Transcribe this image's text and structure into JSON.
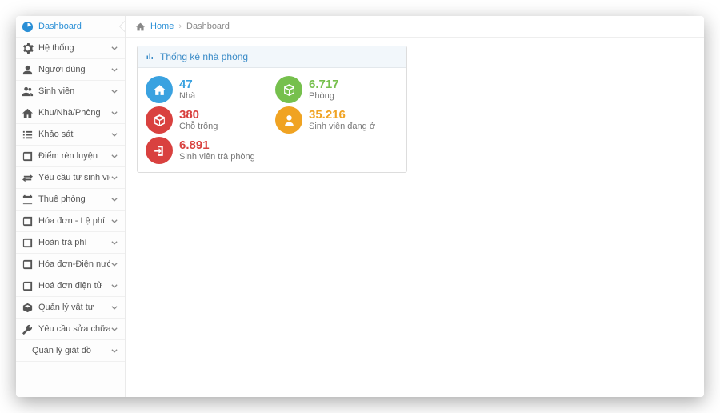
{
  "breadcrumb": {
    "home": "Home",
    "current": "Dashboard"
  },
  "sidebar": {
    "items": [
      {
        "icon": "dashboard",
        "label": "Dashboard",
        "active": true,
        "expandable": false
      },
      {
        "icon": "gears",
        "label": "Hệ thống",
        "active": false,
        "expandable": true
      },
      {
        "icon": "user",
        "label": "Người dùng",
        "active": false,
        "expandable": true
      },
      {
        "icon": "users",
        "label": "Sinh viên",
        "active": false,
        "expandable": true
      },
      {
        "icon": "home",
        "label": "Khu/Nhà/Phòng",
        "active": false,
        "expandable": true
      },
      {
        "icon": "list",
        "label": "Khảo sát",
        "active": false,
        "expandable": true
      },
      {
        "icon": "book",
        "label": "Điểm rèn luyện",
        "active": false,
        "expandable": true
      },
      {
        "icon": "transfer",
        "label": "Yêu cầu từ sinh viên",
        "active": false,
        "expandable": true
      },
      {
        "icon": "calendar",
        "label": "Thuê phòng",
        "active": false,
        "expandable": true
      },
      {
        "icon": "book",
        "label": "Hóa đơn - Lệ phí",
        "active": false,
        "expandable": true
      },
      {
        "icon": "book",
        "label": "Hoàn trả phí",
        "active": false,
        "expandable": true
      },
      {
        "icon": "book",
        "label": "Hóa đơn-Điện nước",
        "active": false,
        "expandable": true
      },
      {
        "icon": "book",
        "label": "Hoá đơn điện tử",
        "active": false,
        "expandable": true
      },
      {
        "icon": "box",
        "label": "Quản lý vật tư",
        "active": false,
        "expandable": true
      },
      {
        "icon": "wrench",
        "label": "Yêu cầu sửa chữa",
        "active": false,
        "expandable": true
      },
      {
        "icon": "",
        "label": "Quản lý giặt đồ",
        "active": false,
        "expandable": true,
        "sub": true
      }
    ]
  },
  "panel": {
    "title": "Thống kê nhà phòng"
  },
  "stats": [
    {
      "icon": "home",
      "color": "#3aa2e0",
      "numColor": "#3aa2e0",
      "value": "47",
      "label": "Nhà"
    },
    {
      "icon": "cube",
      "color": "#76c04d",
      "numColor": "#76c04d",
      "value": "6.717",
      "label": "Phòng"
    },
    {
      "icon": "cube",
      "color": "#d9413f",
      "numColor": "#d9413f",
      "value": "380",
      "label": "Chỗ trống"
    },
    {
      "icon": "person",
      "color": "#f0a322",
      "numColor": "#f0a322",
      "value": "35.216",
      "label": "Sinh viên đang ở"
    },
    {
      "icon": "exit",
      "color": "#d9413f",
      "numColor": "#d9413f",
      "value": "6.891",
      "label": "Sinh viên trả phòng"
    }
  ]
}
